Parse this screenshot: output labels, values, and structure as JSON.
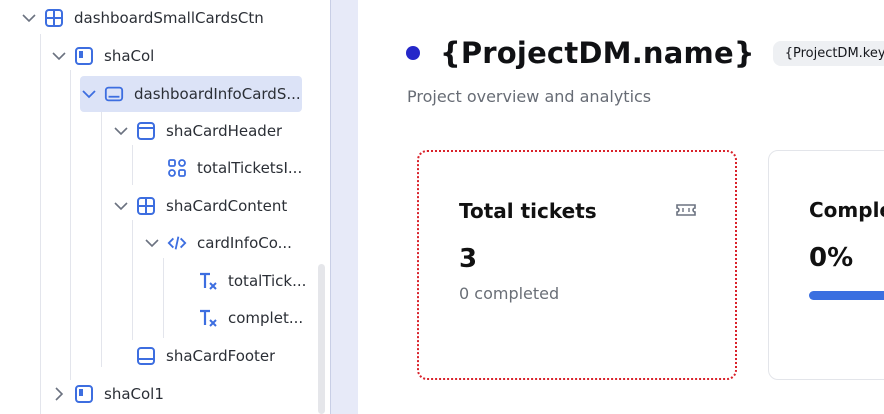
{
  "tree": {
    "nodes": [
      {
        "label": "dashboardSmallCardsCtn",
        "icon": "grid-layout-icon",
        "chevron": "down"
      },
      {
        "label": "shaCol",
        "icon": "column-icon",
        "chevron": "down"
      },
      {
        "label": "dashboardInfoCardS...",
        "icon": "card-icon",
        "chevron": "down",
        "selected": true
      },
      {
        "label": "shaCardHeader",
        "icon": "card-header-icon",
        "chevron": "down"
      },
      {
        "label": "totalTicketsI...",
        "icon": "components-icon",
        "chevron": "none"
      },
      {
        "label": "shaCardContent",
        "icon": "grid-layout-icon",
        "chevron": "down"
      },
      {
        "label": "cardInfoCo...",
        "icon": "code-icon",
        "chevron": "down"
      },
      {
        "label": "totalTick...",
        "icon": "text-icon",
        "chevron": "none"
      },
      {
        "label": "complet...",
        "icon": "text-icon",
        "chevron": "none"
      },
      {
        "label": "shaCardFooter",
        "icon": "card-footer-icon",
        "chevron": "none"
      },
      {
        "label": "shaCol1",
        "icon": "column-icon",
        "chevron": "right"
      }
    ]
  },
  "main": {
    "title": "{ProjectDM.name}",
    "key_badge": "{ProjectDM.key}",
    "subtitle": "Project overview and analytics",
    "cards": [
      {
        "title": "Total tickets",
        "value": "3",
        "sub": "0 completed",
        "icon": "ticket-icon"
      },
      {
        "title": "Comple",
        "value": "0%",
        "progress_percent": 0
      }
    ]
  },
  "colors": {
    "accent": "#2527c9",
    "icon_blue": "#3d6ee0",
    "selected_row": "#dce3f7",
    "card_border_dotted": "#d9222b"
  }
}
